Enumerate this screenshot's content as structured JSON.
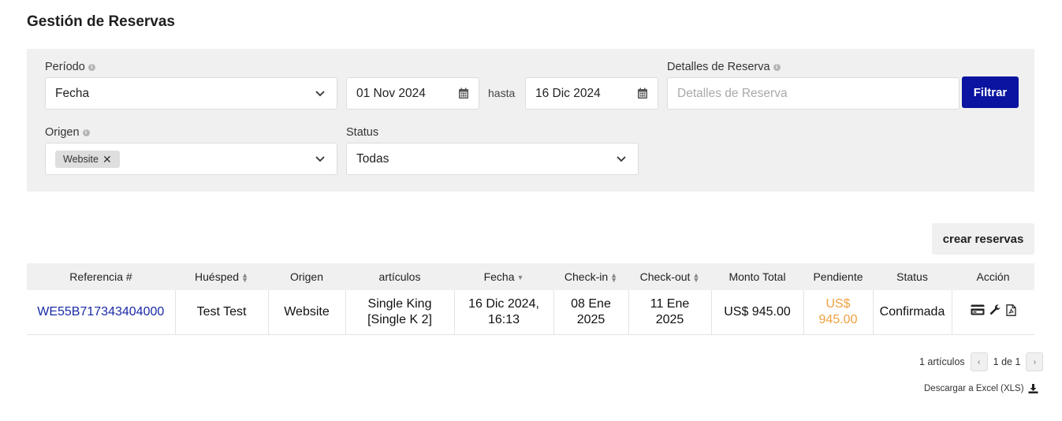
{
  "page": {
    "title": "Gestión de Reservas"
  },
  "filters": {
    "period_label": "Período",
    "period_value": "Fecha",
    "date_from": "01 Nov 2024",
    "until_label": "hasta",
    "date_to": "16 Dic 2024",
    "details_label": "Detalles de Reserva",
    "details_placeholder": "Detalles de Reserva",
    "filter_button": "Filtrar",
    "origin_label": "Origen",
    "origin_chip": "Website",
    "status_label": "Status",
    "status_value": "Todas"
  },
  "create_button": "crear reservas",
  "table": {
    "headers": {
      "reference": "Referencia #",
      "guest": "Huésped",
      "origin": "Origen",
      "items": "artículos",
      "date": "Fecha",
      "checkin": "Check-in",
      "checkout": "Check-out",
      "total": "Monto Total",
      "pending": "Pendiente",
      "status": "Status",
      "action": "Acción"
    },
    "rows": [
      {
        "reference": "WE55B717343404000",
        "guest": "Test Test",
        "origin": "Website",
        "items_line1": "Single King",
        "items_line2": "[Single K 2]",
        "date_line1": "16 Dic 2024,",
        "date_line2": "16:13",
        "checkin_line1": "08 Ene",
        "checkin_line2": "2025",
        "checkout_line1": "11 Ene",
        "checkout_line2": "2025",
        "total": "US$ 945.00",
        "pending_line1": "US$",
        "pending_line2": "945.00",
        "status": "Confirmada"
      }
    ]
  },
  "pagination": {
    "count": "1 artículos",
    "page": "1 de 1",
    "prev": "‹",
    "next": "›"
  },
  "download_label": "Descargar a Excel (XLS)",
  "colors": {
    "primary": "#0a14a0",
    "link": "#1a2aa6",
    "pending": "#f0a040",
    "panel": "#f0f0f0"
  },
  "icons": [
    "info-icon",
    "chevron-down-icon",
    "calendar-icon",
    "close-icon",
    "sort-icon",
    "sort-down-icon",
    "credit-card-icon",
    "wrench-icon",
    "pdf-icon",
    "download-icon"
  ]
}
